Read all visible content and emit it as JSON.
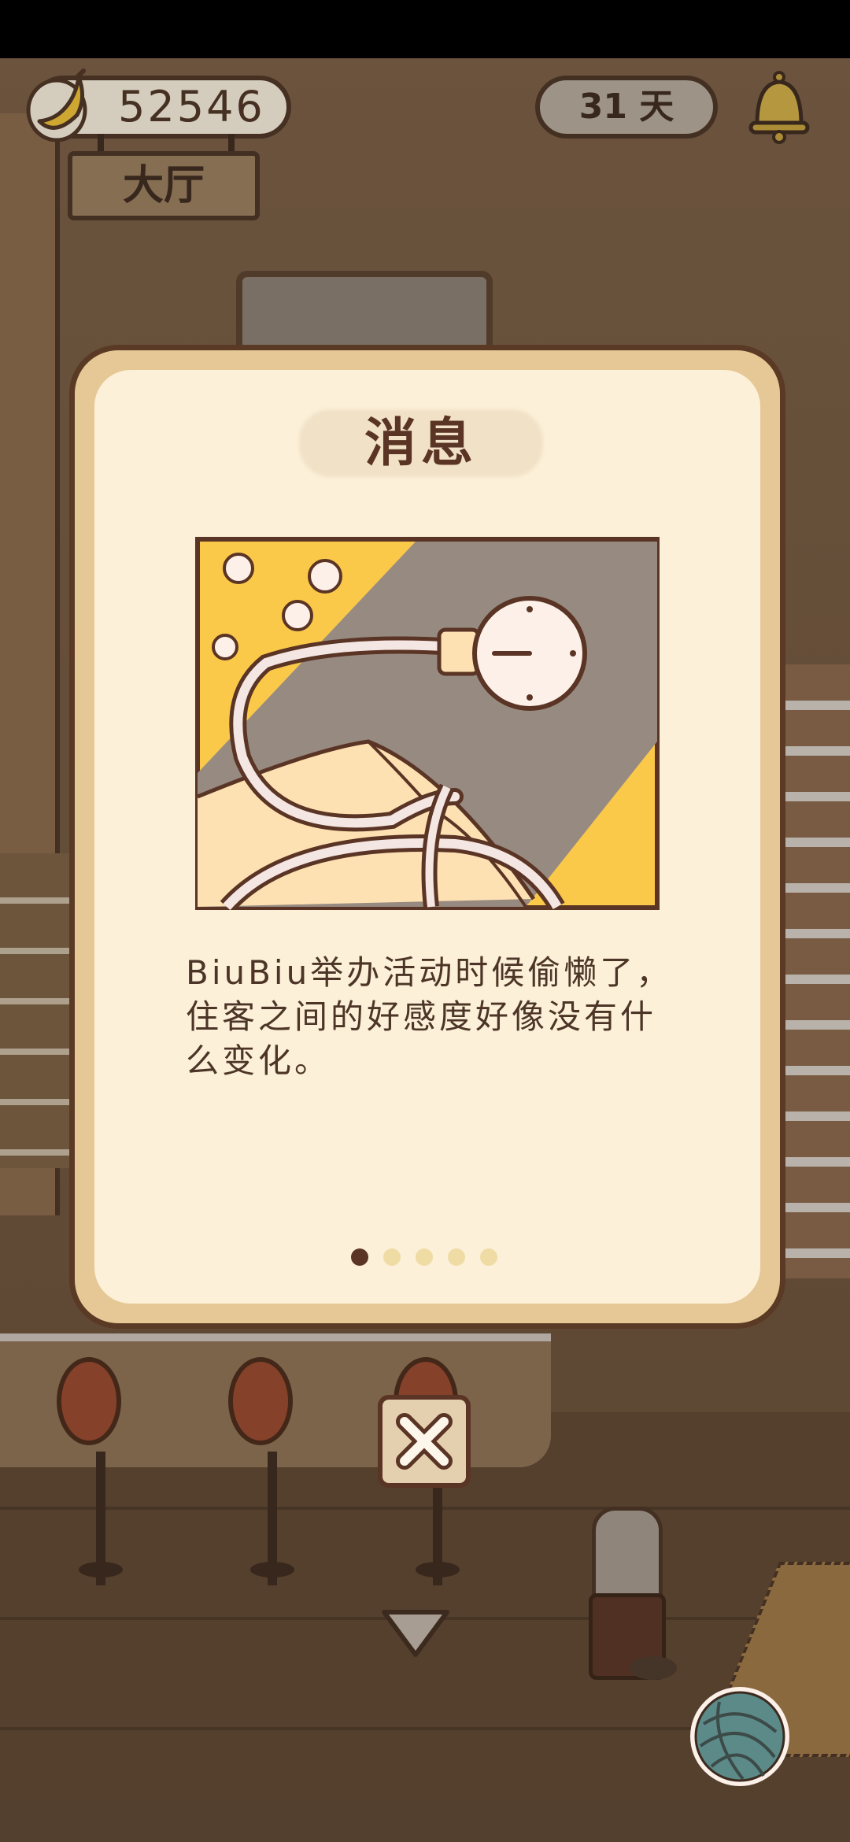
{
  "hud": {
    "coins": "52546",
    "room_label": "大厅",
    "days": "31 天"
  },
  "modal": {
    "title": "消息",
    "message": "BiuBiu举办活动时候偷懒了，住客之间的好感度好像没有什么变化。",
    "page_count": 5,
    "active_page": 1
  },
  "icons": {
    "coin": "banana-icon",
    "notification": "bell-icon",
    "close": "close-icon",
    "collapse": "down-arrow-icon",
    "inventory": "yarn-ball-icon"
  },
  "colors": {
    "modal_border": "#5a3a24",
    "modal_frame": "#e6c896",
    "modal_background": "#fcf0d9",
    "text": "#4c3526",
    "dot_active": "#5a3424",
    "dot_inactive": "#efdba4"
  }
}
